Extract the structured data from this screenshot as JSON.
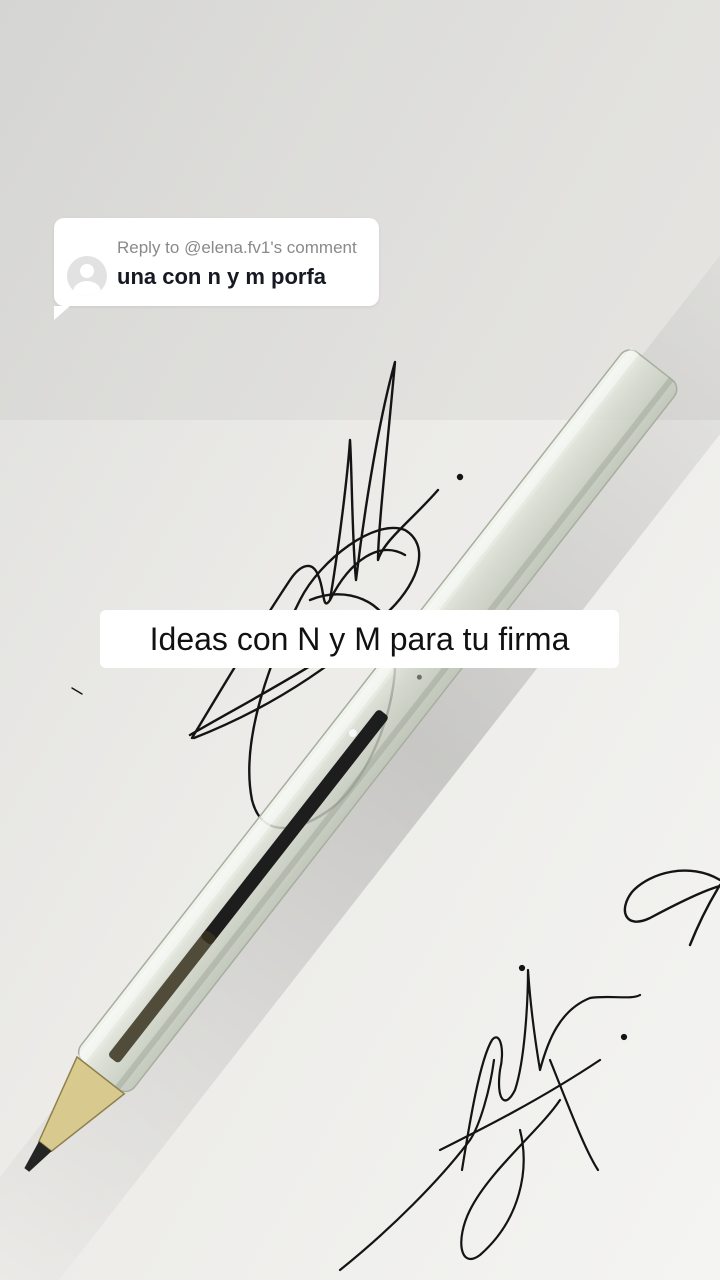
{
  "reply": {
    "header": "Reply to @elena.fv1's comment",
    "text": "una con n y m porfa",
    "avatar_icon": "default-avatar-icon"
  },
  "caption": {
    "text": "Ideas con N y M para tu firma"
  },
  "colors": {
    "paper": "#efefed",
    "ink": "#141414",
    "bubble_bg": "#ffffff"
  }
}
